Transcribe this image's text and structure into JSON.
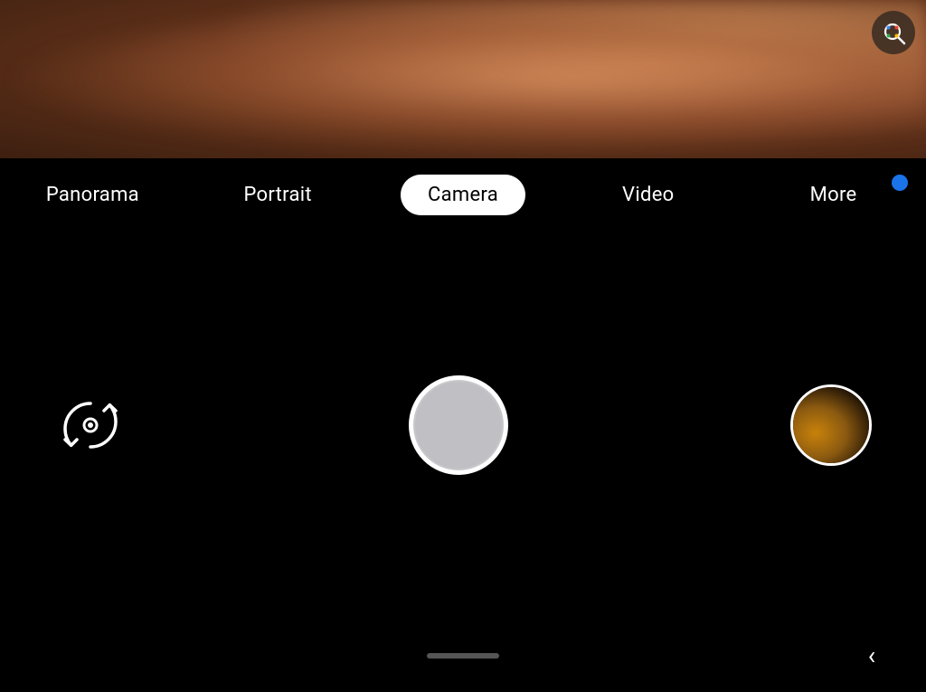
{
  "viewfinder": {
    "alt": "Camera viewfinder showing blurred warm tones"
  },
  "lens_button": {
    "label": "Google Lens",
    "icon": "lens-search-icon"
  },
  "mode_bar": {
    "modes": [
      {
        "id": "panorama",
        "label": "Panorama",
        "active": false
      },
      {
        "id": "portrait",
        "label": "Portrait",
        "active": false
      },
      {
        "id": "camera",
        "label": "Camera",
        "active": true
      },
      {
        "id": "video",
        "label": "Video",
        "active": false
      },
      {
        "id": "more",
        "label": "More",
        "active": false
      }
    ],
    "notification_dot_visible": true
  },
  "controls": {
    "flip_camera_label": "Flip camera",
    "shutter_label": "Take photo",
    "gallery_label": "Gallery thumbnail"
  },
  "bottom_bar": {
    "back_label": "Back"
  }
}
